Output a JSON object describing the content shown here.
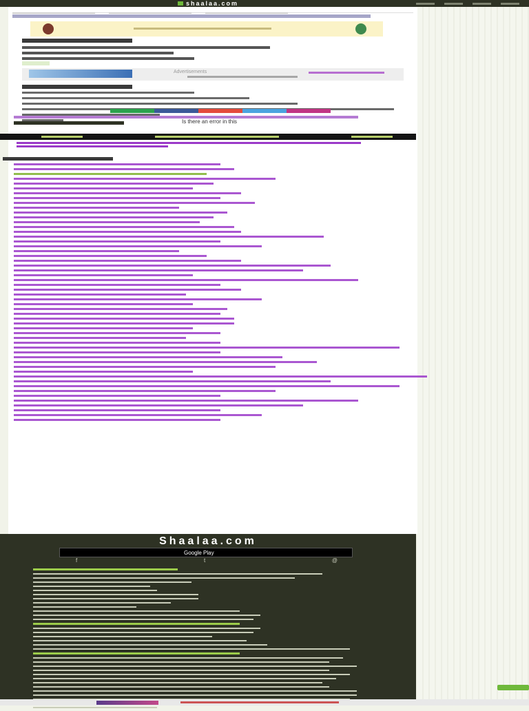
{
  "header": {
    "brand": "shaalaa.com",
    "nav_links": [
      "",
      "",
      "",
      "",
      ""
    ]
  },
  "question": {
    "title": "",
    "body": [
      "",
      "",
      ""
    ],
    "tag": ""
  },
  "ad_strip": {
    "label": "Advertisements",
    "remove": "",
    "copy": ""
  },
  "solution": {
    "tag": "",
    "steps": [
      "",
      "",
      "",
      "",
      "",
      ""
    ]
  },
  "share": {
    "colors": [
      "#2ca24d",
      "#3b5998",
      "#e44b3c",
      "#4aa3df",
      "#c13584"
    ]
  },
  "chapter": {
    "nav_prev": "",
    "nav_title": "",
    "nav_next": "",
    "title": [
      "",
      ""
    ]
  },
  "related": {
    "tag": "",
    "items": 54
  },
  "footer": {
    "brand": "Shaalaa.com",
    "store": "Google Play",
    "social": [
      "f",
      "t",
      "@"
    ]
  },
  "error_label": "Is there an error in this"
}
